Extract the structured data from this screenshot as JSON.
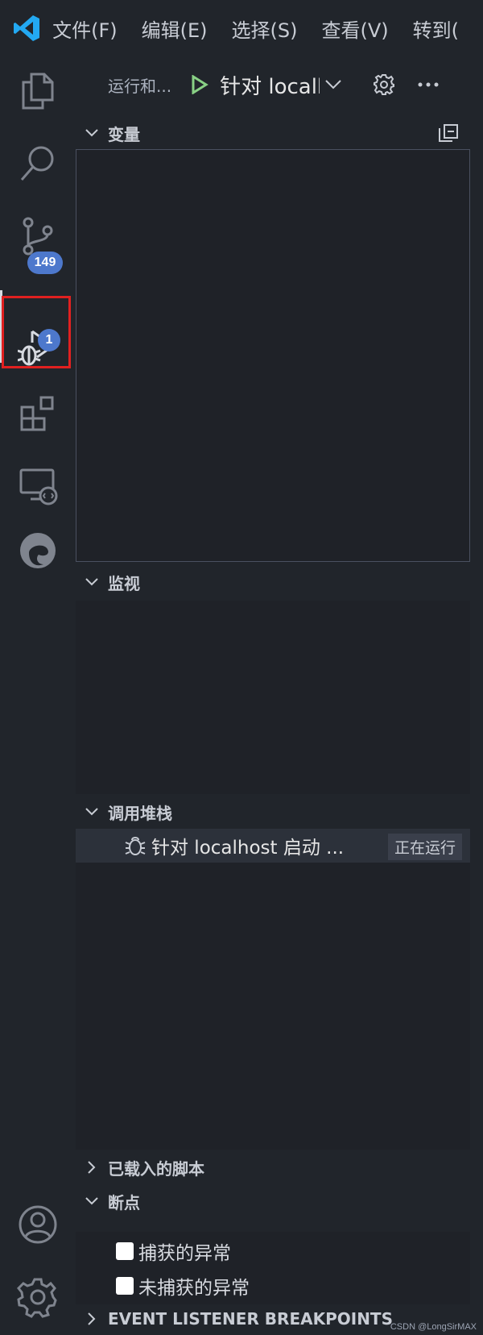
{
  "menu": {
    "file": "文件(F)",
    "edit": "编辑(E)",
    "select": "选择(S)",
    "view": "查看(V)",
    "goto": "转到("
  },
  "activity": {
    "source_control_badge": "149",
    "debug_badge": "1"
  },
  "sidebar": {
    "run_label": "运行和...",
    "config_name": "针对 localh",
    "sections": {
      "variables": "变量",
      "watch": "监视",
      "call_stack": "调用堆栈",
      "loaded_scripts": "已载入的脚本",
      "breakpoints": "断点",
      "event_listener": "EVENT LISTENER BREAKPOINTS"
    },
    "call_stack_item": {
      "label": "针对 localhost 启动 ...",
      "status": "正在运行"
    },
    "breakpoints": {
      "caught": "捕获的异常",
      "uncaught": "未捕获的异常"
    }
  },
  "watermark": "CSDN @LongSirMAX",
  "colors": {
    "badge": "#4d78cc",
    "run_green": "#89d185",
    "highlight_red": "#e02020",
    "vscode_blue": "#23a9f2"
  }
}
